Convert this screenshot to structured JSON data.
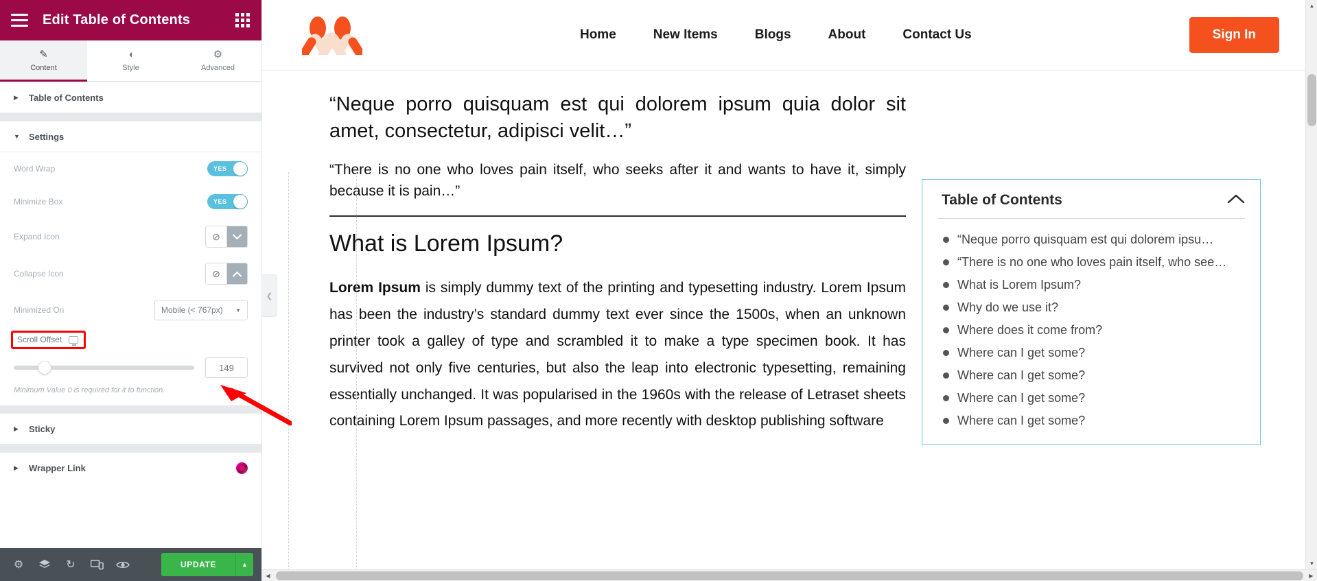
{
  "panel": {
    "header": {
      "title": "Edit Table of Contents",
      "menu_icon": "hamburger-icon",
      "apps_icon": "grid-apps-icon"
    },
    "tabs": [
      {
        "label": "Content",
        "icon": "pencil-icon",
        "active": true
      },
      {
        "label": "Style",
        "icon": "half-circle-icon",
        "active": false
      },
      {
        "label": "Advanced",
        "icon": "gear-icon",
        "active": false
      }
    ],
    "sections": {
      "table_of_contents": {
        "title": "Table of Contents",
        "expanded": false
      },
      "settings": {
        "title": "Settings",
        "expanded": true
      },
      "sticky": {
        "title": "Sticky",
        "expanded": false
      },
      "wrapper_link": {
        "title": "Wrapper Link",
        "expanded": false,
        "badge": "pro-badge"
      }
    },
    "controls": {
      "word_wrap": {
        "label": "Word Wrap",
        "value": "YES"
      },
      "minimize_box": {
        "label": "Minimize Box",
        "value": "YES"
      },
      "expand_icon": {
        "label": "Expand Icon",
        "options": [
          "none",
          "chevron-down"
        ],
        "selected": "chevron-down"
      },
      "collapse_icon": {
        "label": "Collapse Icon",
        "options": [
          "none",
          "chevron-up"
        ],
        "selected": "chevron-up"
      },
      "minimized_on": {
        "label": "Minimized On",
        "value": "Mobile (< 767px)"
      },
      "scroll_offset": {
        "label": "Scroll Offset",
        "device_icon": "desktop-monitor-icon",
        "value": "149",
        "slider_percent": 17,
        "hint": "Minimum Value 0 is required for it to function.",
        "highlighted": true
      }
    },
    "footer": {
      "icons": [
        "gear-icon",
        "layers-icon",
        "history-icon",
        "responsive-mode-icon",
        "eye-preview-icon"
      ],
      "update_label": "UPDATE",
      "update_caret": "chevron-up-icon"
    },
    "collapse_handle": "chevron-left-icon"
  },
  "site": {
    "logo": "brand-logo",
    "nav": [
      {
        "label": "Home"
      },
      {
        "label": "New Items"
      },
      {
        "label": "Blogs"
      },
      {
        "label": "About"
      },
      {
        "label": "Contact Us"
      }
    ],
    "signin_label": "Sign In"
  },
  "article": {
    "quote1": "“Neque porro quisquam est qui dolorem ipsum quia dolor sit amet, consectetur, adipisci velit…”",
    "quote2": "“There is no one who loves pain itself, who seeks after it and wants to have it, simply because it is pain…”",
    "heading": "What is Lorem Ipsum?",
    "lead_bold": "Lorem Ipsum",
    "paragraph": " is simply dummy text of the printing and typesetting industry. Lorem Ipsum has been the industry’s standard dummy text ever since the 1500s, when an unknown printer took a galley of type and scrambled it to make a type specimen book. It has survived not only five centuries, but also the leap into electronic typesetting, remaining essentially unchanged. It was popularised in the 1960s with the release of Letraset sheets containing Lorem Ipsum passages, and more recently with desktop publishing software"
  },
  "toc_widget": {
    "title": "Table of Contents",
    "toggle_icon": "chevron-up-icon",
    "items": [
      "“Neque porro quisquam est qui dolorem ipsu…",
      "“There is no one who loves pain itself, who see…",
      "What is Lorem Ipsum?",
      "Why do we use it?",
      "Where does it come from?",
      "Where can I get some?",
      "Where can I get some?",
      "Where can I get some?",
      "Where can I get some?"
    ]
  },
  "colors": {
    "panel_header": "#9b0a46",
    "accent_orange": "#f4511e",
    "switch_on": "#5bc0de",
    "update_green": "#39b54a",
    "highlight_red": "#ff0000",
    "toc_border": "#6ec1e4"
  }
}
